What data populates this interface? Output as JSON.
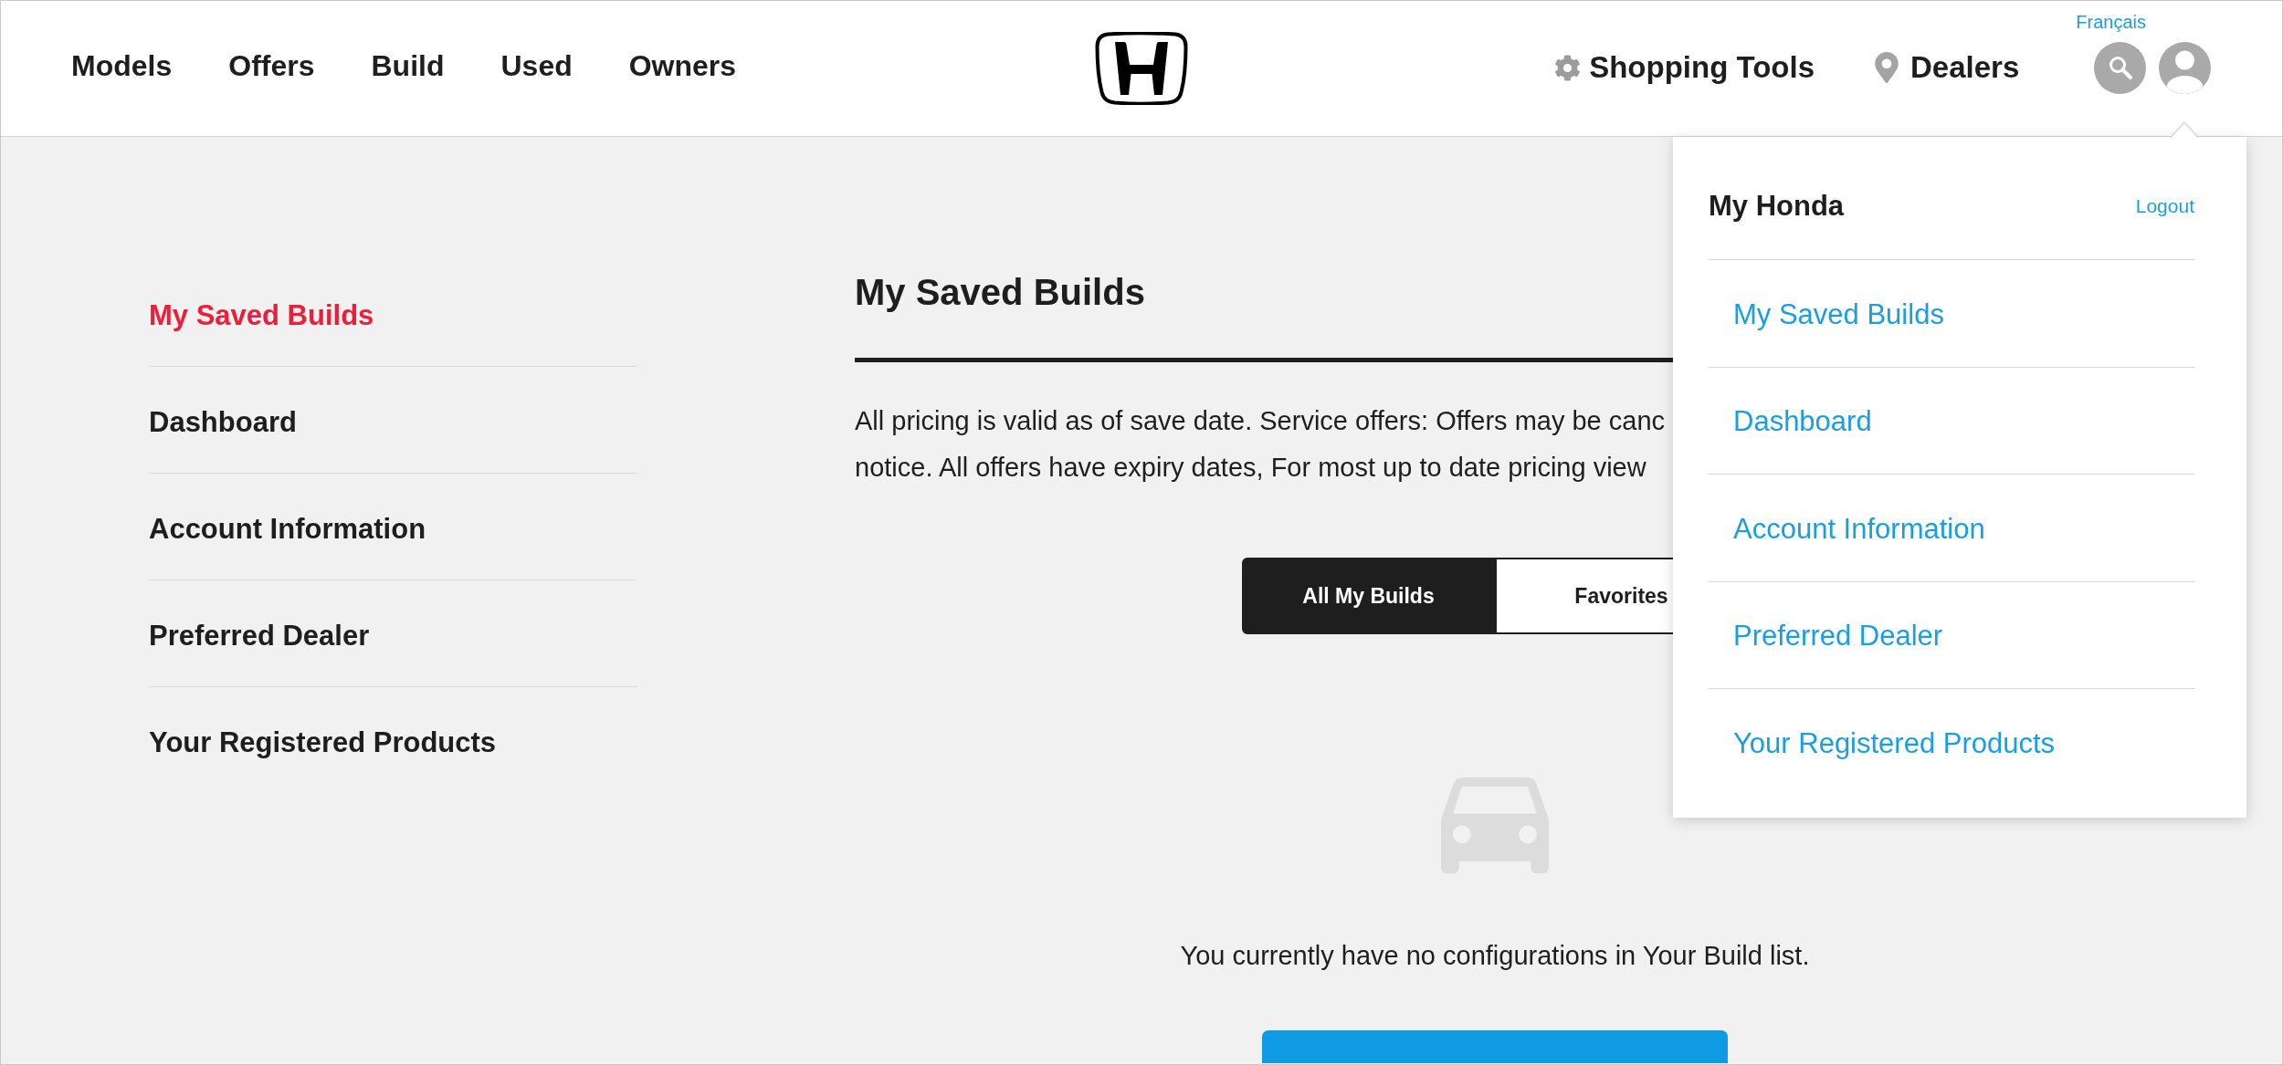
{
  "header": {
    "nav": [
      "Models",
      "Offers",
      "Build",
      "Used",
      "Owners"
    ],
    "utility_links": [
      {
        "kind": "gear",
        "label": "Shopping Tools"
      },
      {
        "kind": "pin",
        "label": "Dealers"
      }
    ],
    "language_link": "Français"
  },
  "account_menu": {
    "open": true,
    "title": "My Honda",
    "logout": "Logout",
    "items": [
      "My Saved Builds",
      "Dashboard",
      "Account Information",
      "Preferred Dealer",
      "Your Registered Products"
    ]
  },
  "sidebar": {
    "items": [
      {
        "label": "My Saved Builds",
        "selected": true
      },
      {
        "label": "Dashboard",
        "selected": false
      },
      {
        "label": "Account Information",
        "selected": false
      },
      {
        "label": "Preferred Dealer",
        "selected": false
      },
      {
        "label": "Your Registered Products",
        "selected": false
      }
    ]
  },
  "main": {
    "title": "My Saved Builds",
    "notice_lines": [
      "All pricing is valid as of save date. Service offers: Offers may be canc",
      "notice. All offers have expiry dates, For most up to date pricing view"
    ],
    "tabs": [
      {
        "label": "All My Builds",
        "selected": true
      },
      {
        "label": "Favorites",
        "selected": false
      }
    ],
    "empty_message": "You currently have no configurations in Your Build list."
  }
}
